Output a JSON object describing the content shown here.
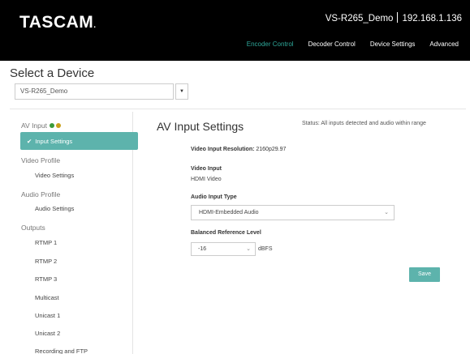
{
  "header": {
    "logo": "TASCAM",
    "device_name": "VS-R265_Demo",
    "ip_address": "192.168.1.136",
    "nav": [
      "Encoder Control",
      "Decoder Control",
      "Device Settings",
      "Advanced"
    ],
    "active_nav": "Encoder Control",
    "accent_color": "#2ea89a"
  },
  "device_selector": {
    "title": "Select a Device",
    "selected": "VS-R265_Demo"
  },
  "sidebar": {
    "av_input": "AV Input",
    "input_settings": "Input Settings",
    "video_profile": "Video Profile",
    "video_settings": "Video Settings",
    "audio_profile": "Audio Profile",
    "audio_settings": "Audio Settings",
    "outputs": "Outputs",
    "rtmp1": "RTMP 1",
    "rtmp2": "RTMP 2",
    "rtmp3": "RTMP 3",
    "multicast": "Multicast",
    "unicast1": "Unicast 1",
    "unicast2": "Unicast 2",
    "recording_ftp": "Recording and FTP",
    "status_ok_color": "#3a9b3a",
    "status_warn_color": "#c9a01a"
  },
  "main": {
    "title": "AV Input Settings",
    "status": "Status: All inputs detected and audio within range",
    "resolution_label": "Video Input Resolution:",
    "resolution_value": "2160p29.97",
    "video_input_label": "Video Input",
    "video_input_value": "HDMI Video",
    "audio_input_type_label": "Audio Input Type",
    "audio_input_type_value": "HDMI-Embedded Audio",
    "balanced_ref_label": "Balanced Reference Level",
    "balanced_ref_value": "-16",
    "balanced_ref_unit": "dBFS",
    "save_label": "Save"
  }
}
